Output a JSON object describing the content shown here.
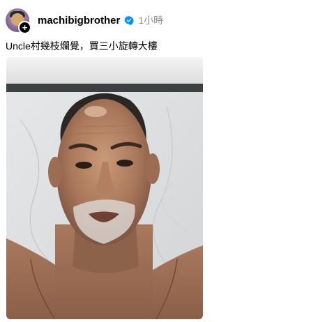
{
  "post": {
    "username": "machibigbrother",
    "time": "1小時",
    "caption": "Uncle村幾枝爛覺，買三小旋轉大樓",
    "follow_badge": "+",
    "icons": {
      "verified": "verified-badge-icon",
      "follow": "plus-icon"
    },
    "colors": {
      "verified_blue": "#0095f6",
      "timestamp_gray": "#8e8e8e",
      "text": "#000000"
    }
  }
}
